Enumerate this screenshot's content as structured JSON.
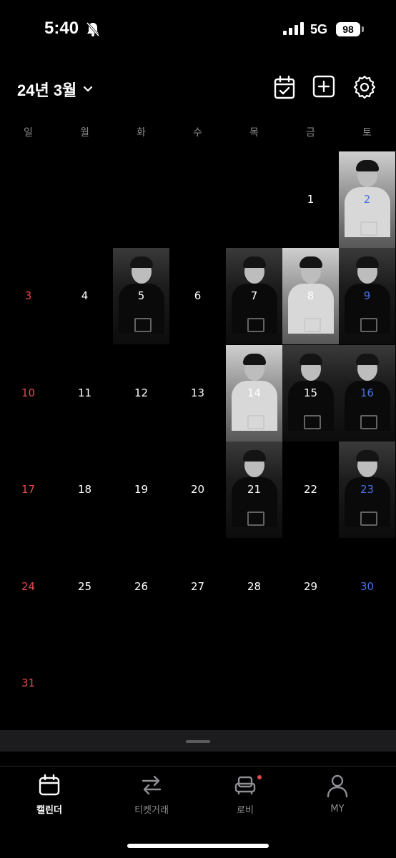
{
  "status_bar": {
    "time": "5:40",
    "network": "5G",
    "battery": "98"
  },
  "header": {
    "title": "24년 3월"
  },
  "weekdays": [
    "일",
    "월",
    "화",
    "수",
    "목",
    "금",
    "토"
  ],
  "calendar": {
    "days": [
      "1",
      "2",
      "3",
      "4",
      "5",
      "6",
      "7",
      "8",
      "9",
      "10",
      "11",
      "12",
      "13",
      "14",
      "15",
      "16",
      "17",
      "18",
      "19",
      "20",
      "21",
      "22",
      "23",
      "24",
      "25",
      "26",
      "27",
      "28",
      "29",
      "30",
      "31"
    ],
    "days_with_poster": [
      "2",
      "5",
      "7",
      "8",
      "9",
      "14",
      "15",
      "16",
      "21",
      "23"
    ]
  },
  "colors": {
    "sunday": "#e5484d",
    "saturday": "#4a72e0",
    "background": "#000000"
  },
  "tabs": [
    {
      "label": "캘린더",
      "icon": "calendar-icon",
      "active": true
    },
    {
      "label": "티켓거래",
      "icon": "swap-arrows-icon",
      "active": false
    },
    {
      "label": "로비",
      "icon": "sofa-icon",
      "active": false
    },
    {
      "label": "MY",
      "icon": "person-icon",
      "active": false
    }
  ]
}
